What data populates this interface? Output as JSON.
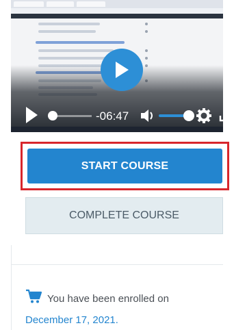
{
  "video": {
    "time_remaining": "-06:47",
    "progress_fraction": 0.12,
    "volume_fraction": 0.82
  },
  "buttons": {
    "start_label": "START COURSE",
    "complete_label": "COMPLETE COURSE"
  },
  "enrollment": {
    "text": "You have been enrolled on",
    "date": "December 17, 2021."
  },
  "colors": {
    "accent": "#2385cf",
    "highlight_border": "#d8262c",
    "complete_bg": "#e3ecf0"
  }
}
